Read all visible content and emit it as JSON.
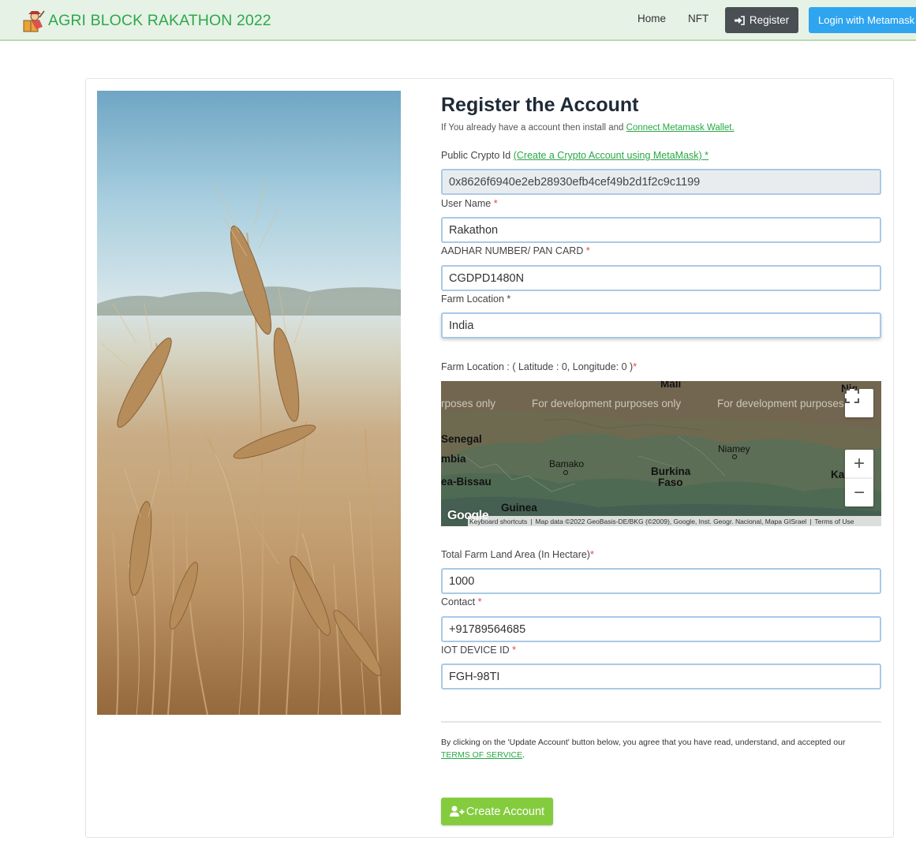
{
  "navbar": {
    "brand": "AGRI BLOCK RAKATHON 2022",
    "links": {
      "home": "Home",
      "nft": "NFT"
    },
    "register_label": "Register",
    "login_label": "Login with Metamask"
  },
  "form": {
    "title": "Register the Account",
    "subtitle_text": "If You already have a account then install and ",
    "subtitle_link": "Connect Metamask Wallet.",
    "public_id": {
      "label": "Public Crypto Id ",
      "link": "(Create a Crypto Account using MetaMask) *",
      "value": "0x8626f6940e2eb28930efb4cef49b2d1f2c9c1199"
    },
    "user_name": {
      "label": "User Name ",
      "required": "*",
      "value": "Rakathon"
    },
    "aadhar": {
      "label": "AADHAR NUMBER/ PAN CARD ",
      "required": "*",
      "value": "CGDPD1480N"
    },
    "farm_location": {
      "label": "Farm Location *",
      "value": "India"
    },
    "map_label": "Farm Location : ( Latitude : 0, Longitude: 0 )",
    "map_required": "*",
    "land_area": {
      "label": "Total Farm Land Area (In Hectare)",
      "required": "*",
      "value": "1000"
    },
    "contact": {
      "label": "Contact ",
      "required": "*",
      "value": "+91789564685"
    },
    "iot": {
      "label": "IOT DEVICE ID ",
      "required": "*",
      "value": "FGH-98TI"
    },
    "terms_text": "By clicking on the 'Update Account' button below, you agree that you have read, understand, and accepted our",
    "terms_link": "TERMS OF SERVICE",
    "terms_end": ".",
    "create_label": "Create Account"
  },
  "map": {
    "watermarks": [
      "rposes only",
      "For development purposes only",
      "For development purposes"
    ],
    "places": {
      "mali": "Mali",
      "senegal": "Senegal",
      "gambia": "mbia",
      "guinea_bissau": "ea-Bissau",
      "bamako": "Bamako",
      "burkina1": "Burkina",
      "burkina2": "Faso",
      "niamey": "Niamey",
      "guinea": "Guinea",
      "niger_partial": "Niger",
      "kan_partial": "Kar"
    },
    "zoom_in": "+",
    "zoom_out": "−",
    "footer": {
      "shortcuts": "Keyboard shortcuts",
      "data": "Map data ©2022 GeoBasis-DE/BKG (©2009), Google, Inst. Geogr. Nacional, Mapa GISrael",
      "terms": "Terms of Use"
    },
    "google": "Google"
  },
  "colors": {
    "brand": "#2ea84a",
    "register_bg": "#4a4f54",
    "login_bg": "#2fa5f0",
    "create_bg": "#84cc3e",
    "link": "#28a745"
  }
}
